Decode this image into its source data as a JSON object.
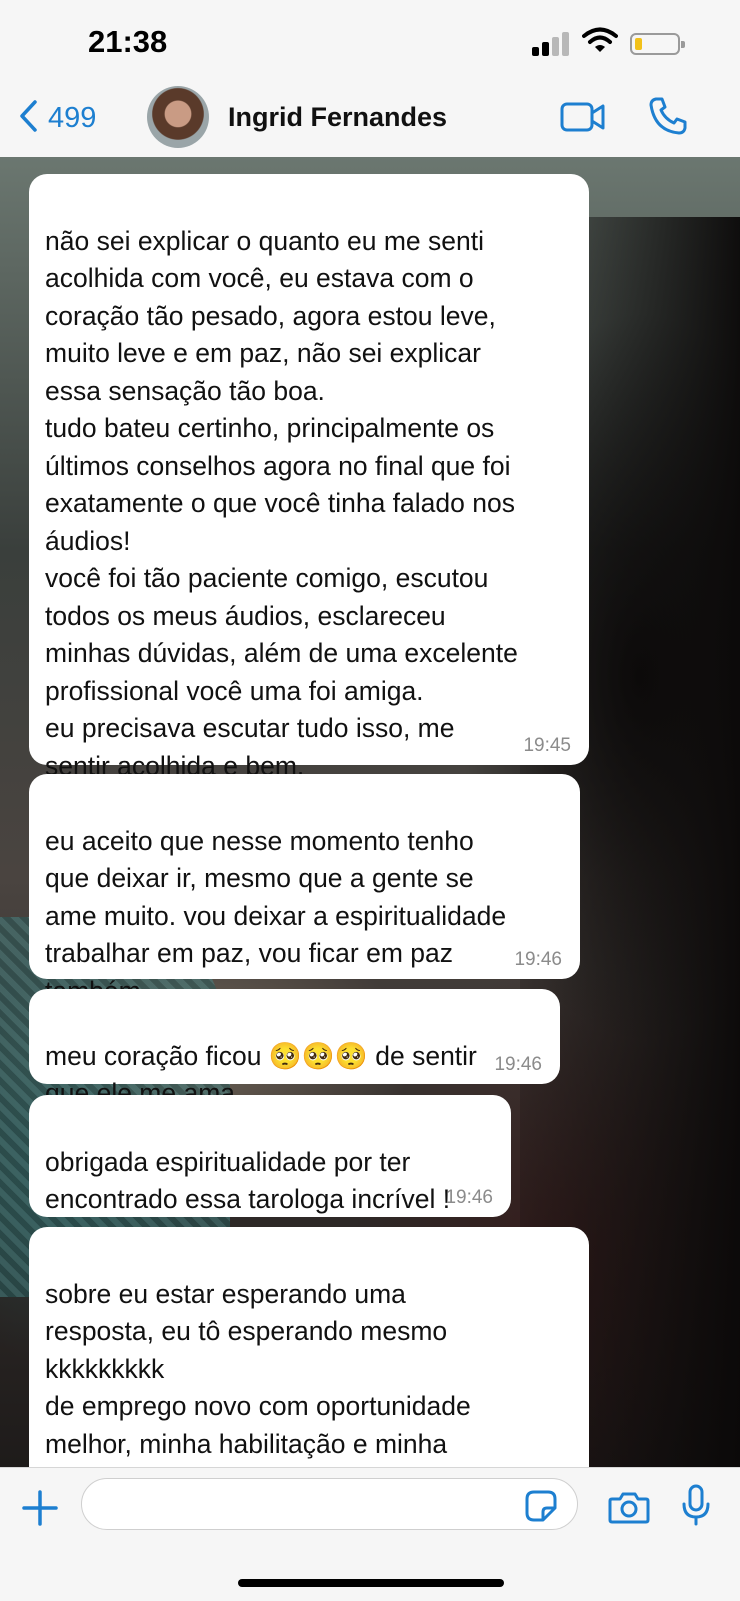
{
  "status_bar": {
    "time": "21:38"
  },
  "header": {
    "back_count": "499",
    "contact_name": "Ingrid Fernandes"
  },
  "messages": [
    {
      "text": "não sei explicar o quanto eu me senti\nacolhida com você, eu estava com o\ncoração tão pesado, agora estou leve,\nmuito leve e em paz, não sei explicar\nessa sensação tão boa.\ntudo bateu certinho, principalmente os\núltimos conselhos agora no final que foi\nexatamente o que você tinha falado nos\náudios!\nvocê foi tão paciente comigo, escutou\ntodos os meus áudios, esclareceu\nminhas dúvidas, além de uma excelente\nprofissional você uma foi amiga.\neu precisava escutar tudo isso, me\nsentir acolhida e bem.",
      "time": "19:45"
    },
    {
      "text": "eu aceito que nesse momento tenho\nque deixar ir, mesmo que a gente se\name muito. vou deixar a espiritualidade\ntrabalhar em paz, vou ficar em paz\ntambém",
      "time": "19:46"
    },
    {
      "text": "meu coração ficou 🥺🥺🥺 de sentir\nque ele me ama",
      "time": "19:46"
    },
    {
      "text": "obrigada espiritualidade por ter\nencontrado essa tarologa incrível !",
      "time": "19:46"
    },
    {
      "text": "sobre eu estar esperando uma\nresposta, eu tô esperando mesmo\nkkkkkkkkk\nde emprego novo com oportunidade\nmelhor, minha habilitação e minha\nfaculdade, a notícia boa deve ser de um",
      "time": ""
    }
  ],
  "input": {
    "placeholder": ""
  },
  "icons": {
    "back": "chevron-left-icon",
    "video": "video-camera-icon",
    "call": "phone-icon",
    "plus": "plus-icon",
    "sticker": "sticker-icon",
    "camera": "camera-icon",
    "mic": "microphone-icon"
  },
  "colors": {
    "accent": "#1d7fd0",
    "bar_background": "#f6f6f6",
    "bubble_background": "#ffffff",
    "timestamp": "#8b8b8b",
    "battery_level": "#f2c11a"
  }
}
